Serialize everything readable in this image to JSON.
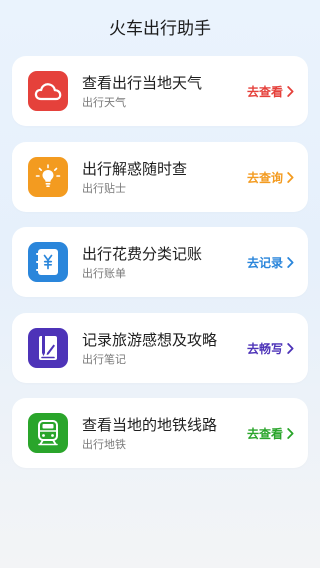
{
  "header": {
    "title": "火车出行助手"
  },
  "cards": [
    {
      "title": "查看出行当地天气",
      "subtitle": "出行天气",
      "action": "去查看",
      "color": "#e5413b",
      "icon": "cloud-icon"
    },
    {
      "title": "出行解惑随时查",
      "subtitle": "出行贴士",
      "action": "去查询",
      "color": "#f39b20",
      "icon": "lightbulb-icon"
    },
    {
      "title": "出行花费分类记账",
      "subtitle": "出行账单",
      "action": "去记录",
      "color": "#2a86db",
      "icon": "yuan-ledger-icon"
    },
    {
      "title": "记录旅游感想及攻略",
      "subtitle": "出行笔记",
      "action": "去畅写",
      "color": "#4d33b8",
      "icon": "pen-note-icon"
    },
    {
      "title": "查看当地的地铁线路",
      "subtitle": "出行地铁",
      "action": "去查看",
      "color": "#2aa52b",
      "icon": "subway-icon"
    }
  ]
}
